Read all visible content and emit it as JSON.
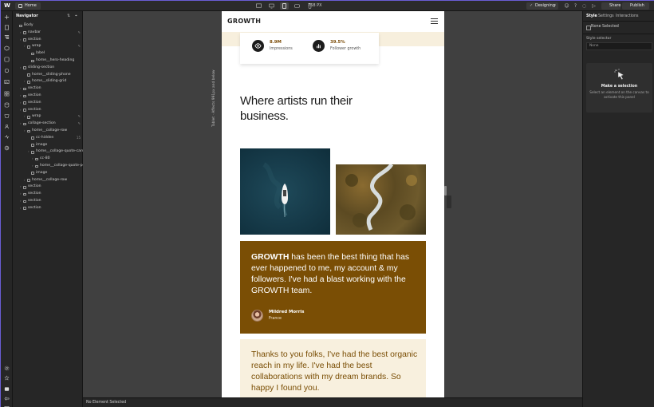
{
  "app": {
    "logo": "W",
    "page_name": "Home",
    "viewport_label": "768 PX",
    "mode": "Designing",
    "share_label": "Share",
    "publish_label": "Publish"
  },
  "navigator": {
    "title": "Navigator",
    "items": [
      {
        "label": "Body",
        "depth": 0,
        "caret": false,
        "badge": ""
      },
      {
        "label": "navbar",
        "depth": 1,
        "caret": true,
        "badge": "✎"
      },
      {
        "label": "section",
        "depth": 1,
        "caret": true,
        "badge": ""
      },
      {
        "label": "wrap",
        "depth": 2,
        "caret": true,
        "badge": "✎"
      },
      {
        "label": "label",
        "depth": 3,
        "caret": false,
        "badge": ""
      },
      {
        "label": "home__hero-heading",
        "depth": 3,
        "caret": false,
        "badge": ""
      },
      {
        "label": "sliding-section",
        "depth": 1,
        "caret": true,
        "badge": ""
      },
      {
        "label": "home__sliding-phone",
        "depth": 2,
        "caret": false,
        "badge": ""
      },
      {
        "label": "home__sliding-grid",
        "depth": 2,
        "caret": true,
        "badge": ""
      },
      {
        "label": "section",
        "depth": 1,
        "caret": true,
        "badge": ""
      },
      {
        "label": "section",
        "depth": 1,
        "caret": true,
        "badge": ""
      },
      {
        "label": "section",
        "depth": 1,
        "caret": true,
        "badge": ""
      },
      {
        "label": "section",
        "depth": 1,
        "caret": true,
        "badge": ""
      },
      {
        "label": "wrap",
        "depth": 2,
        "caret": true,
        "badge": "✎"
      },
      {
        "label": "collage-section",
        "depth": 1,
        "caret": true,
        "badge": "✎"
      },
      {
        "label": "home__collage-row",
        "depth": 2,
        "caret": true,
        "badge": ""
      },
      {
        "label": "cc-hidden",
        "depth": 3,
        "caret": false,
        "badge": "15"
      },
      {
        "label": "image",
        "depth": 3,
        "caret": false,
        "badge": ""
      },
      {
        "label": "home__collage-quote-card",
        "depth": 3,
        "caret": true,
        "badge": ""
      },
      {
        "label": "cc-80",
        "depth": 4,
        "caret": true,
        "badge": ""
      },
      {
        "label": "home__collage-quote-person",
        "depth": 4,
        "caret": true,
        "badge": ""
      },
      {
        "label": "image",
        "depth": 3,
        "caret": false,
        "badge": ""
      },
      {
        "label": "home__collage-row",
        "depth": 2,
        "caret": true,
        "badge": ""
      },
      {
        "label": "section",
        "depth": 1,
        "caret": true,
        "badge": ""
      },
      {
        "label": "section",
        "depth": 1,
        "caret": true,
        "badge": ""
      },
      {
        "label": "section",
        "depth": 1,
        "caret": true,
        "badge": ""
      },
      {
        "label": "section",
        "depth": 1,
        "caret": true,
        "badge": ""
      }
    ]
  },
  "canvas": {
    "side_label": "Tablet · Affects 991px and below",
    "status": "No Element Selected"
  },
  "site": {
    "brand": "GROWTH",
    "stats": [
      {
        "value": "8.9M",
        "label": "Impressions",
        "icon": "eye-icon"
      },
      {
        "value": "39.5%",
        "label": "Follower growth",
        "icon": "bar-chart-icon"
      }
    ],
    "headline": "Where artists run their business.",
    "quote": {
      "brand": "GROWTH",
      "text": " has been the best thing that has ever happened to me, my account & my followers. I've had a blast working with the GROWTH team.",
      "name": "Mildred Morris",
      "location": "France"
    },
    "quote2": {
      "text": "Thanks to you folks, I've had the best organic reach in my life. I've had the best collaborations with my dream brands. So happy I found you."
    }
  },
  "right_panel": {
    "tabs": [
      "Style",
      "Settings",
      "Interactions"
    ],
    "none_selected": "None Selected",
    "style_selector_label": "Style selector",
    "style_selector_value": "None",
    "make_selection_title": "Make a selection",
    "make_selection_desc": "Select an element on the canvas to activate this panel"
  },
  "colors": {
    "accent_brown": "#7a4e05",
    "beige": "#f8f0de",
    "ui_border": "#6a5dd4"
  }
}
